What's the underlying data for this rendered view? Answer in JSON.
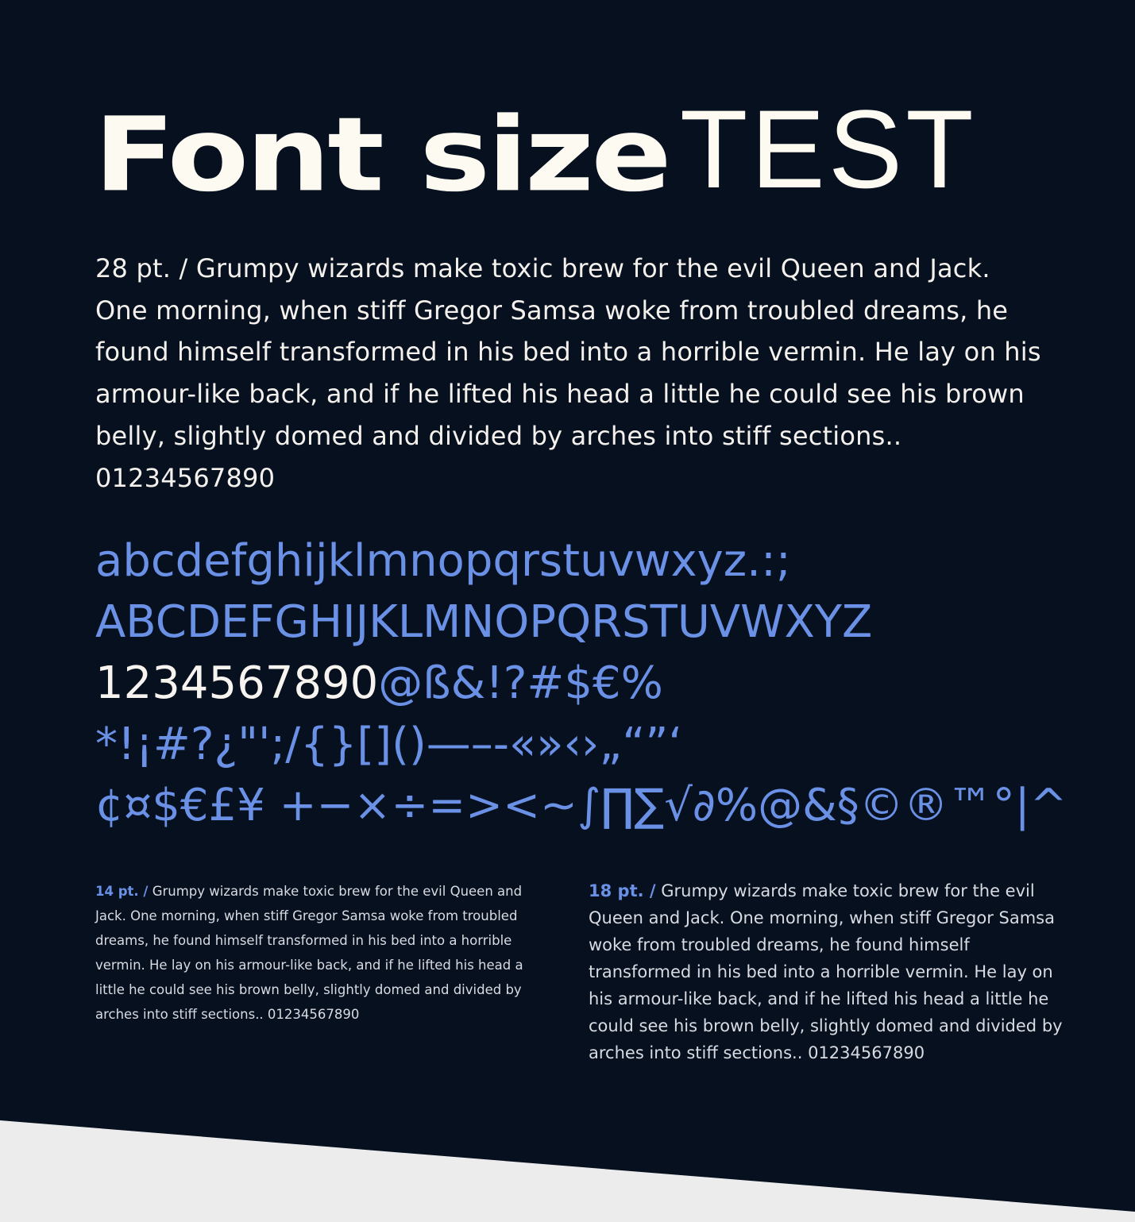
{
  "title": {
    "bold": "Font size",
    "light": "TEST"
  },
  "sample_28": {
    "text": "28 pt. / Grumpy wizards make toxic brew for the evil Queen and Jack. One morning, when stiff Gregor Samsa woke from troubled dreams, he found himself transformed in his bed into a horrible vermin. He lay on his armour-like back, and if he lifted his head a little he could see his brown belly, slightly domed and divided by arches into stiff sections.. 01234567890"
  },
  "character_set": {
    "lowercase": "abcdefghijklmnopqrstuvwxyz.:;",
    "uppercase": "ABCDEFGHIJKLMNOPQRSTUVWXYZ",
    "digits": "1234567890",
    "digit_symbols": "@ß&!?#$€%",
    "punctuation": "*!¡#?¿\"';/{}[]()—–-«»‹›„“”‘",
    "symbols": "¢¤$€£¥ +−×÷=><~∫∏∑√∂%@&§©®™°|^"
  },
  "sample_14": {
    "label": "14 pt. /",
    "text": " Grumpy wizards make toxic brew for the evil Queen and Jack. One morning, when stiff Gregor Samsa woke from troubled dreams, he found himself transformed in his bed into a horrible vermin. He lay on his armour-like back, and if he lifted his head a little he could see his brown belly, slightly domed and divided by arches into stiff sections.. 01234567890"
  },
  "sample_18": {
    "label": "18 pt. /",
    "text": " Grumpy wizards make toxic brew for the evil Queen and Jack. One morning, when stiff Gregor Samsa woke from troubled dreams, he found himself transformed in his bed into a horrible vermin. He lay on his armour-like back, and if he lifted his head a little he could see his brown belly, slightly domed and divided by arches into stiff sections.. 01234567890"
  },
  "colors": {
    "background": "#06101f",
    "text_light": "#fdfaf2",
    "accent_blue": "#6a91e6",
    "paper": "#ececec"
  }
}
